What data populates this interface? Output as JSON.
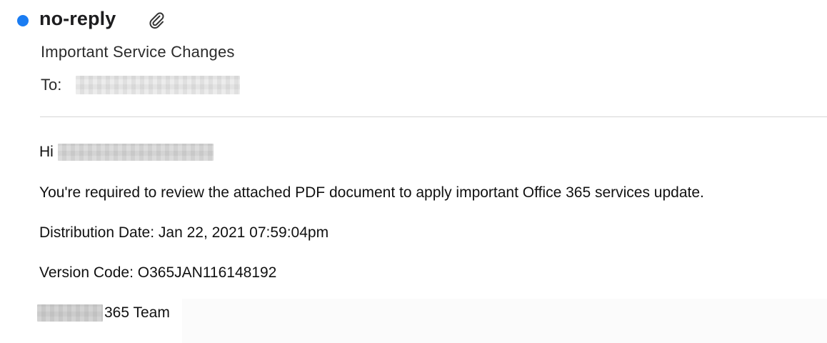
{
  "colors": {
    "accent": "#1a7cf2"
  },
  "header": {
    "sender": "no-reply",
    "attachment_icon": "paperclip-icon",
    "subject": "Important Service Changes",
    "to_label": "To:"
  },
  "body": {
    "greeting": "Hi",
    "line1": "You're required to review the attached PDF document to apply important Office 365 services update.",
    "line2": "Distribution Date: Jan 22, 2021 07:59:04pm",
    "line3": "Version Code: O365JAN116148192",
    "signature": "365 Team"
  }
}
